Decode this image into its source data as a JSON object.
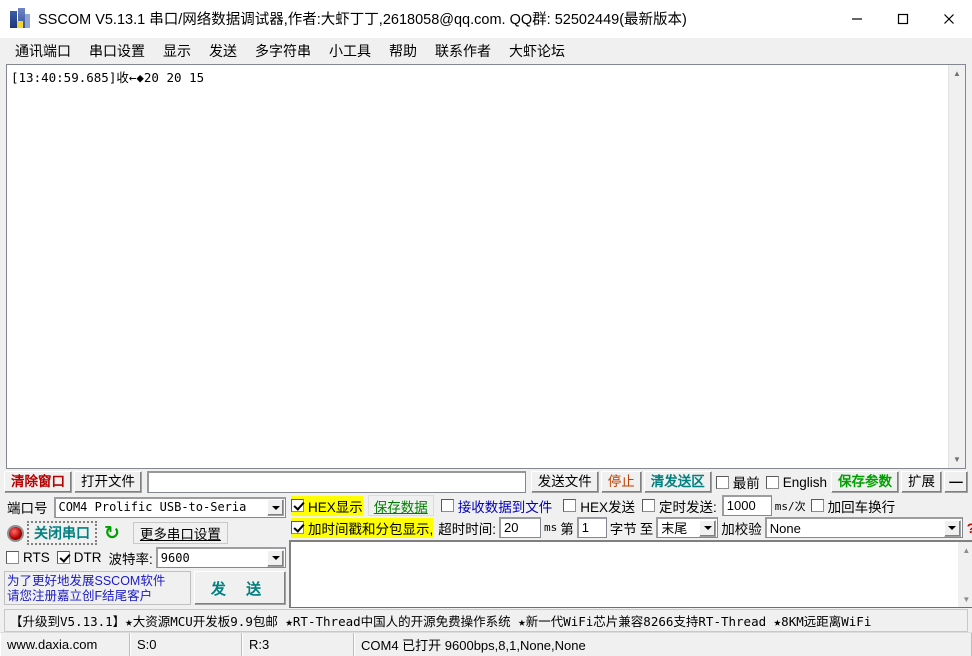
{
  "window": {
    "title": "SSCOM V5.13.1 串口/网络数据调试器,作者:大虾丁丁,2618058@qq.com. QQ群: 52502449(最新版本)",
    "minimize": "—",
    "maximize": "□",
    "close": "✕"
  },
  "menu": {
    "items": [
      {
        "label": "通讯端口"
      },
      {
        "label": "串口设置"
      },
      {
        "label": "显示"
      },
      {
        "label": "发送"
      },
      {
        "label": "多字符串"
      },
      {
        "label": "小工具"
      },
      {
        "label": "帮助"
      },
      {
        "label": "联系作者"
      },
      {
        "label": "大虾论坛"
      }
    ]
  },
  "receive": {
    "content": "[13:40:59.685]收←◆20 20 15 "
  },
  "toolbar": {
    "clear_window": "清除窗口",
    "open_file": "打开文件",
    "file_path": "",
    "send_file": "发送文件",
    "stop": "停止",
    "clear_send": "清发送区",
    "topmost_label": "最前",
    "topmost_checked": false,
    "english_label": "English",
    "english_checked": false,
    "save_params": "保存参数",
    "extend": "扩展",
    "collapse": "—"
  },
  "settings": {
    "port_label": "端口号",
    "port_value": "COM4 Prolific USB-to-Seria",
    "close_port_button": "关闭串口",
    "refresh_icon": "↻",
    "more_port_settings": "更多串口设置",
    "rts_label": "RTS",
    "rts_checked": false,
    "dtr_label": "DTR",
    "dtr_checked": true,
    "baud_label": "波特率:",
    "baud_value": "9600",
    "hex_display_label": "HEX显示",
    "hex_display_checked": true,
    "save_data_button": "保存数据",
    "recv_to_file_label": "接收数据到文件",
    "recv_to_file_checked": false,
    "hex_send_label": "HEX发送",
    "hex_send_checked": false,
    "timed_send_label": "定时发送:",
    "timed_send_checked": false,
    "timed_send_value": "1000",
    "timed_send_unit": "ms/次",
    "crlf_label": "加回车换行",
    "crlf_checked": false,
    "timestamp_label": "加时间戳和分包显示,",
    "timestamp_checked": true,
    "timeout_label": "超时时间:",
    "timeout_value": "20",
    "timeout_unit": "ms",
    "byte_from_label": "第",
    "byte_from_value": "1",
    "byte_mid_label": "字节",
    "byte_to_label": "至",
    "byte_end_value": "末尾",
    "checksum_label": "加校验",
    "checksum_value": "None",
    "help_mark": "?"
  },
  "send": {
    "text": "",
    "notice": "为了更好地发展SSCOM软件\n请您注册嘉立创F结尾客户",
    "send_button": "发 送"
  },
  "ad": {
    "text": "【升级到V5.13.1】★大资源MCU开发板9.9包邮 ★RT-Thread中国人的开源免费操作系统 ★新一代WiFi芯片兼容8266支持RT-Thread ★8KM远距离WiFi"
  },
  "status": {
    "site": "www.daxia.com",
    "sent": "S:0",
    "received": "R:3",
    "connection": "COM4 已打开  9600bps,8,1,None,None"
  }
}
